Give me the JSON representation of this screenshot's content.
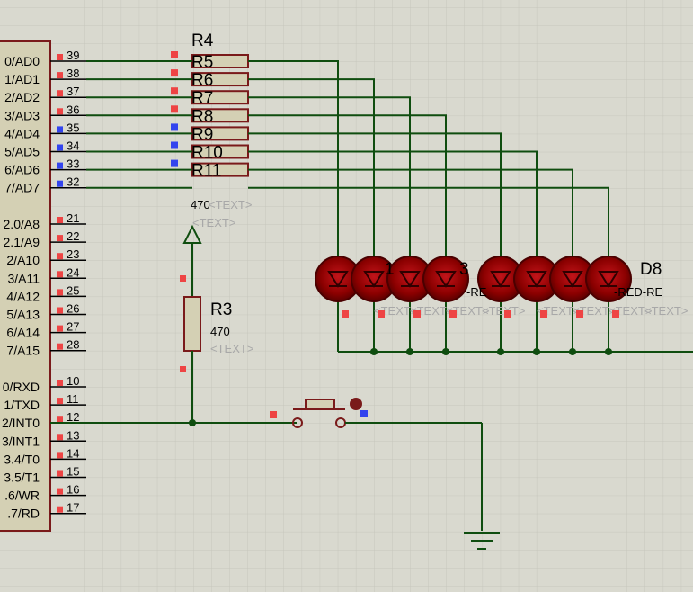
{
  "colors": {
    "background": "#d9d9cf",
    "grid": "#c6c6bc",
    "wire": "#0f4d0f",
    "component": "#7a1a1a",
    "component_fill": "#d4d0b4",
    "pin_red": "#ee4444",
    "pin_blue": "#3344ee",
    "led_body": "#8b0000",
    "led_edge": "#4a0000",
    "ground": "#0f4d0f"
  },
  "mcu": {
    "port0_pins": [
      {
        "signal": "0/AD0",
        "number": "39",
        "state": "red"
      },
      {
        "signal": "1/AD1",
        "number": "38",
        "state": "red"
      },
      {
        "signal": "2/AD2",
        "number": "37",
        "state": "red"
      },
      {
        "signal": "3/AD3",
        "number": "36",
        "state": "red"
      },
      {
        "signal": "4/AD4",
        "number": "35",
        "state": "blue"
      },
      {
        "signal": "5/AD5",
        "number": "34",
        "state": "blue"
      },
      {
        "signal": "6/AD6",
        "number": "33",
        "state": "blue"
      },
      {
        "signal": "7/AD7",
        "number": "32",
        "state": "blue"
      }
    ],
    "port2_pins": [
      {
        "signal": "2.0/A8",
        "number": "21"
      },
      {
        "signal": "2.1/A9",
        "number": "22"
      },
      {
        "signal": "2/A10",
        "number": "23"
      },
      {
        "signal": "3/A11",
        "number": "24"
      },
      {
        "signal": "4/A12",
        "number": "25"
      },
      {
        "signal": "5/A13",
        "number": "26"
      },
      {
        "signal": "6/A14",
        "number": "27"
      },
      {
        "signal": "7/A15",
        "number": "28"
      }
    ],
    "port3_pins": [
      {
        "signal": "0/RXD",
        "number": "10"
      },
      {
        "signal": "1/TXD",
        "number": "11"
      },
      {
        "signal": "2/INT0",
        "number": "12"
      },
      {
        "signal": "3/INT1",
        "number": "13"
      },
      {
        "signal": "3.4/T0",
        "number": "14"
      },
      {
        "signal": "3.5/T1",
        "number": "15"
      },
      {
        "signal": ".6/WR",
        "number": "16"
      },
      {
        "signal": ".7/RD",
        "number": "17"
      }
    ]
  },
  "resistor_pack": {
    "labels": [
      "R4",
      "R5",
      "R6",
      "R7",
      "R8",
      "R9",
      "R10",
      "R11"
    ],
    "value": "470",
    "text_placeholder": "<TEXT>"
  },
  "resistor_r3": {
    "label": "R3",
    "value": "470",
    "text_placeholder": "<TEXT>"
  },
  "leds": {
    "visible_labels": [
      "1",
      "3",
      "D8"
    ],
    "part_texts": [
      "-RE",
      "-RED-RE"
    ],
    "text_placeholders": [
      "<TEXT>",
      "<TEXT>",
      "<TEXT>",
      "<TEXT>",
      "<TEXT>",
      "<TEXT>",
      "<TEXT>",
      "<TEXT>"
    ]
  }
}
